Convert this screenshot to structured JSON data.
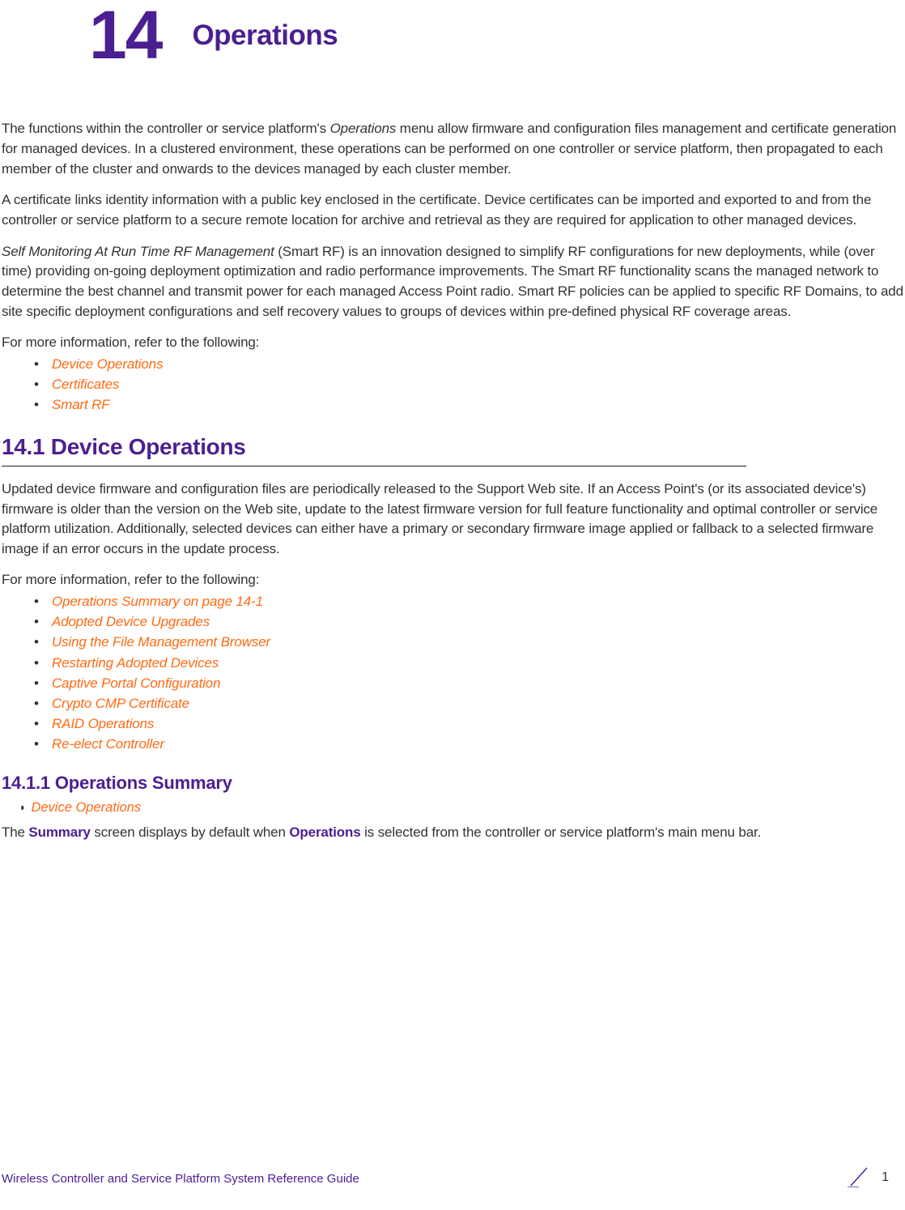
{
  "chapter": {
    "number": "14",
    "title": "Operations"
  },
  "intro": {
    "p1a": "The functions within the controller or service platform's ",
    "p1_ital": "Operations",
    "p1b": " menu allow firmware and configuration files management and certificate generation for managed devices. In a clustered environment, these operations can be performed on one controller or service platform, then propagated to each member of the cluster and onwards to the devices managed by each cluster member.",
    "p2": "A certificate links identity information with a public key enclosed in the certificate. Device certificates can be imported and exported to and from the controller or service platform to a secure remote location for archive and retrieval as they are required for application to other managed devices.",
    "p3_ital": "Self Monitoring At Run Time RF Management",
    "p3a": " (Smart RF) is an innovation designed to simplify RF configurations for new deployments, while (over time) providing on-going deployment optimization and radio performance improvements. The Smart RF functionality scans the managed network to determine the best channel and transmit power for each managed Access Point radio. Smart RF policies can be applied to specific RF Domains, to add site specific deployment configurations and self recovery values to groups of devices within pre-defined physical RF coverage areas.",
    "p4": "For more information, refer to the following:",
    "links": [
      "Device Operations",
      "Certificates",
      "Smart RF"
    ]
  },
  "sec_14_1": {
    "heading": "14.1 Device Operations",
    "p1": "Updated device firmware and configuration files are periodically released to the Support Web site. If an Access Point's (or its associated device's) firmware is older than the version on the Web site, update to the latest firmware version for full feature functionality and optimal controller or service platform utilization. Additionally, selected devices can either have a primary or secondary firmware image applied or fallback to a selected firmware image if an error occurs in the update process.",
    "p2": "For more information, refer to the following:",
    "links": [
      "Operations Summary on page 14-1",
      "Adopted Device Upgrades",
      "Using the File Management Browser",
      "Restarting Adopted Devices",
      "Captive Portal Configuration",
      "Crypto CMP Certificate",
      "RAID Operations",
      "Re-elect Controller"
    ]
  },
  "sec_14_1_1": {
    "heading": "14.1.1 Operations Summary",
    "breadcrumb": "Device Operations",
    "p1a": "The ",
    "p1_bold1": "Summary",
    "p1b": " screen displays by default when ",
    "p1_bold2": "Operations",
    "p1c": " is selected from the controller or service platform's main menu bar."
  },
  "footer": {
    "guide": "Wireless Controller and Service Platform System Reference Guide",
    "page": "1"
  }
}
